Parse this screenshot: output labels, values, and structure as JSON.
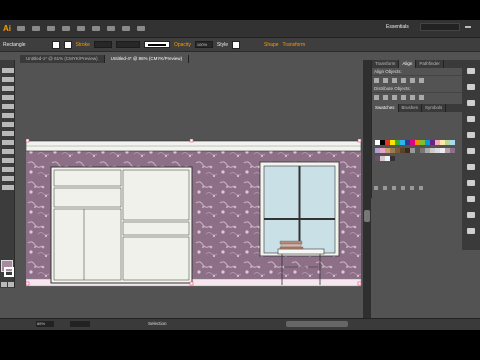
{
  "app": {
    "logo": "Ai",
    "workspace": "Essentials",
    "brand_color": "#ff9a00"
  },
  "control_bar": {
    "selection_type": "Rectangle",
    "stroke_label": "Stroke",
    "opacity_label": "Opacity",
    "opacity_value": "100%",
    "style_label": "Style",
    "shape_label": "Shape",
    "transform_label": "Transform"
  },
  "doc_tabs": [
    {
      "label": "Untitled-1* @ 61% (CMYK/Preview)",
      "active": false
    },
    {
      "label": "Untitled-4* @ 86% (CMYK/Preview)",
      "active": true
    }
  ],
  "panels": {
    "top_tabs": [
      "Transform",
      "Align",
      "Pathfinder"
    ],
    "align_objects": "Align Objects:",
    "distribute_objects": "Distribute Objects:",
    "bottom_tabs": [
      "Swatches",
      "Brushes",
      "Symbols"
    ]
  },
  "status_bar": {
    "zoom": "86%",
    "tool": "Selection"
  },
  "tools": {
    "fill_color": "#a78a9e"
  }
}
